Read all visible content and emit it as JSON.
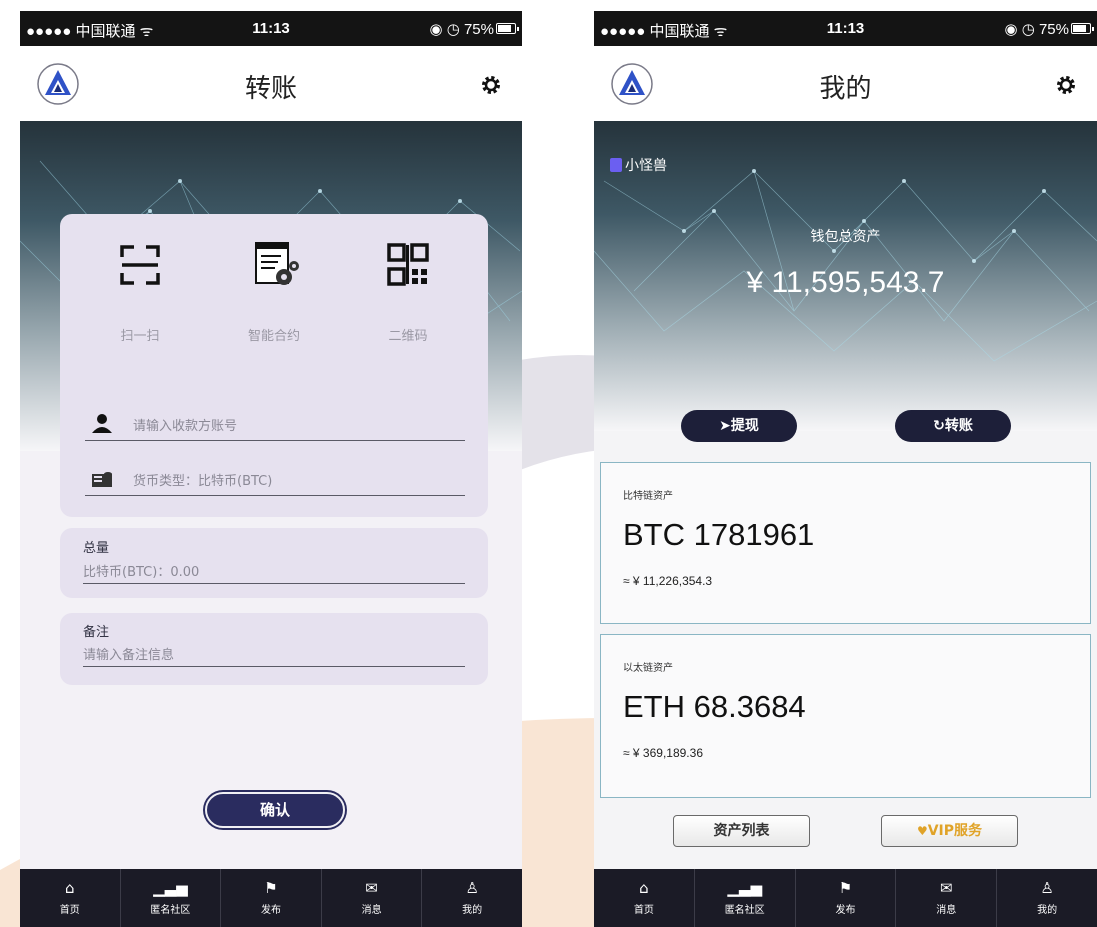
{
  "left_screen": {
    "status": {
      "carrier": "●●●●● 中国联通 ᯤ",
      "time": "11:13",
      "right": "◉ ◷ 75%"
    },
    "nav": {
      "title": "转账",
      "logo_icon": "triangle-logo-icon",
      "settings_icon": "gear-icon"
    },
    "quick_actions": [
      {
        "label": "扫一扫",
        "icon": "scan-icon"
      },
      {
        "label": "智能合约",
        "icon": "smart-contract-icon"
      },
      {
        "label": "二维码",
        "icon": "qr-code-icon"
      }
    ],
    "fields": {
      "recipient_placeholder": "请输入收款方账号",
      "currency_label": "货币类型：比特币(BTC)"
    },
    "amount": {
      "label": "总量",
      "value": "比特币(BTC)：0.00"
    },
    "note": {
      "label": "备注",
      "placeholder": "请输入备注信息"
    },
    "confirm_label": "确认"
  },
  "right_screen": {
    "status": {
      "carrier": "●●●●● 中国联通 ᯤ",
      "time": "11:13",
      "right": "◉ ◷ 75%"
    },
    "nav": {
      "title": "我的",
      "logo_icon": "triangle-logo-icon",
      "settings_icon": "gear-icon"
    },
    "user_name": "小怪兽",
    "wallet_label": "钱包总资产",
    "wallet_total": "¥ 11,595,543.7",
    "actions": {
      "withdraw": "➤提现",
      "transfer": "↻转账"
    },
    "assets": [
      {
        "label": "比特链资产",
        "amount": "BTC 1781961",
        "fiat": "≈ ¥ 11,226,354.3"
      },
      {
        "label": "以太链资产",
        "amount": "ETH 68.3684",
        "fiat": "≈ ¥ 369,189.36"
      }
    ],
    "buttons": {
      "asset_list": "资产列表",
      "vip": "VIP服务"
    }
  },
  "tab_bar": [
    {
      "label": "首页",
      "icon": "home-icon",
      "glyph": "⌂"
    },
    {
      "label": "匿名社区",
      "icon": "signal-icon",
      "glyph": "▁▃▅"
    },
    {
      "label": "发布",
      "icon": "flag-icon",
      "glyph": "⚑"
    },
    {
      "label": "消息",
      "icon": "mail-icon",
      "glyph": "✉"
    },
    {
      "label": "我的",
      "icon": "person-icon",
      "glyph": "♙"
    }
  ],
  "colors": {
    "accent_navy": "#2a2c5f",
    "tab_bar": "#1b1b26",
    "card_lavender": "#e6e1ef",
    "vip_gold": "#e0a328",
    "asset_border": "#8ab6c4"
  }
}
